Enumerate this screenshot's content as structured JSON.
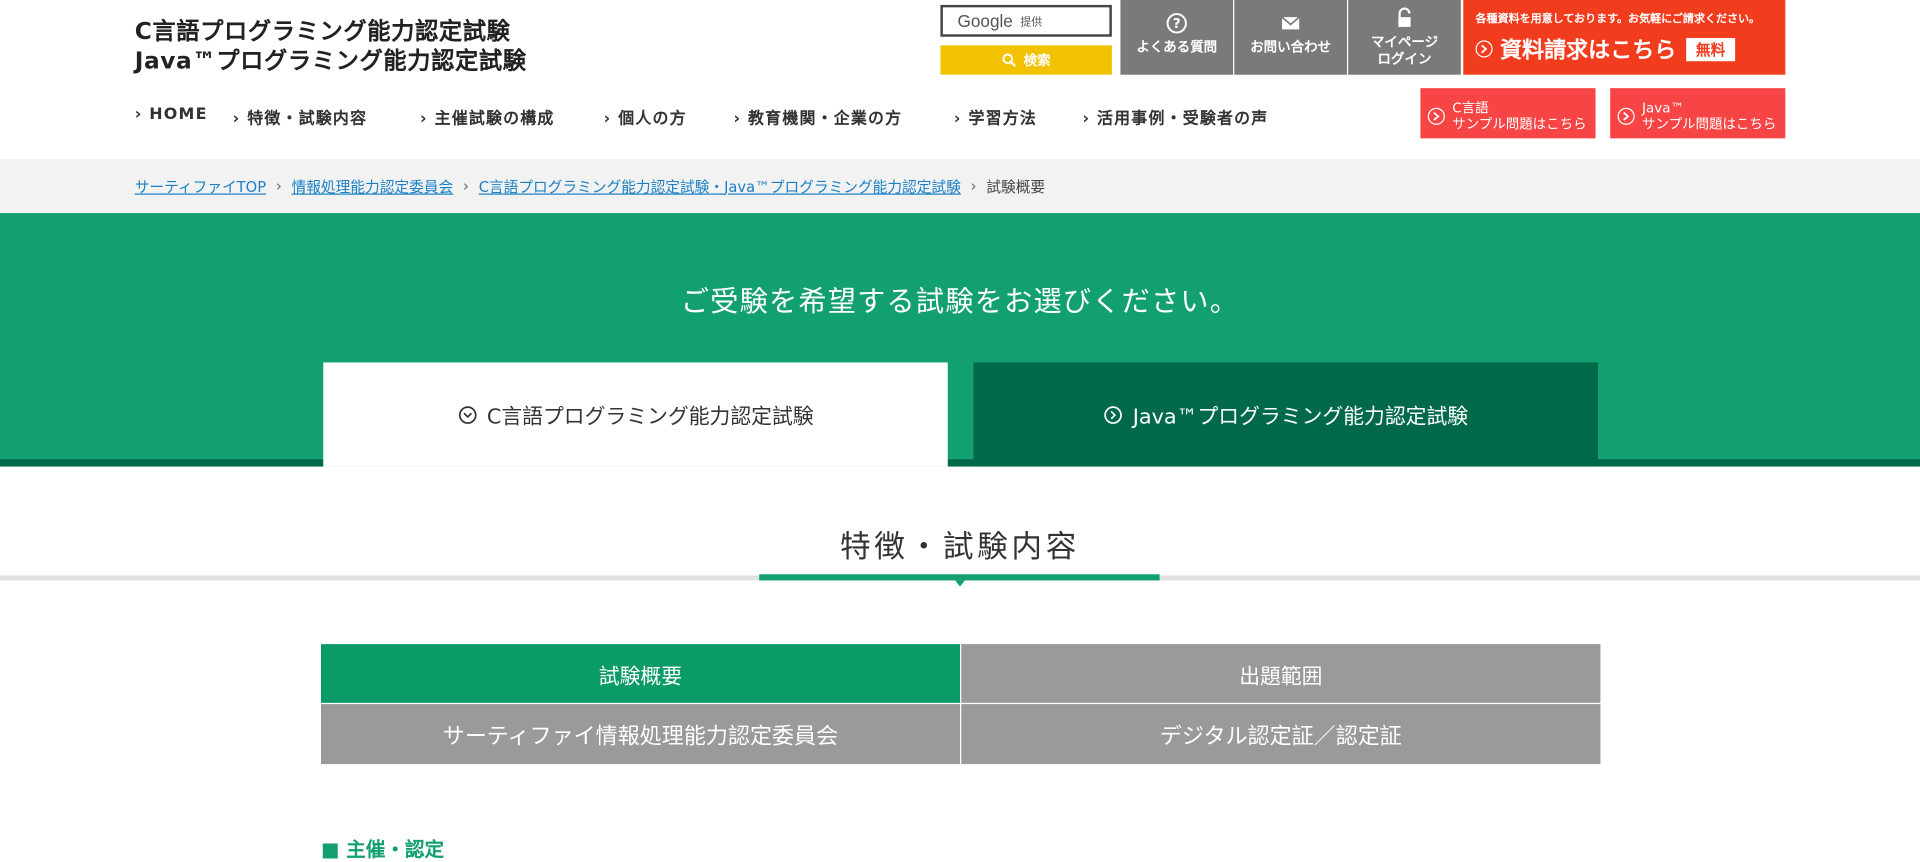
{
  "site": {
    "title_line1": "C言語プログラミング能力認定試験",
    "title_line2": "Java™プログラミング能力認定試験"
  },
  "search": {
    "brand": "Google",
    "provided": "提供",
    "button_label": "検索"
  },
  "utility": [
    {
      "label1": "よくある質問",
      "label2": ""
    },
    {
      "label1": "お問い合わせ",
      "label2": ""
    },
    {
      "label1": "マイページ",
      "label2": "ログイン"
    }
  ],
  "request": {
    "small_text": "各種資料を用意しております。お気軽にご請求ください。",
    "big_text": "資料請求はこちら",
    "free_badge": "無料"
  },
  "nav": [
    "HOME",
    "特徴・試験内容",
    "主催試験の構成",
    "個人の方",
    "教育機関・企業の方",
    "学習方法",
    "活用事例・受験者の声"
  ],
  "samples": [
    {
      "line1": "C言語",
      "line2": "サンプル問題はこちら"
    },
    {
      "line1": "Java™",
      "line2": "サンプル問題はこちら"
    }
  ],
  "breadcrumb": {
    "items": [
      "サーティファイTOP",
      "情報処理能力認定委員会",
      "C言語プログラミング能力認定試験・Java™プログラミング能力認定試験"
    ],
    "current": "試験概要"
  },
  "hero": {
    "title": "ご受験を希望する試験をお選びください。",
    "tab_c": "C言語プログラミング能力認定試験",
    "tab_java": "Java™プログラミング能力認定試験"
  },
  "section": {
    "title": "特徴・試験内容"
  },
  "menu": [
    {
      "label": "試験概要",
      "active": true
    },
    {
      "label": "出題範囲",
      "active": false
    },
    {
      "label": "サーティファイ情報処理能力認定委員会",
      "active": false
    },
    {
      "label": "デジタル認定証／認定証",
      "active": false
    }
  ],
  "sub_heading": "■ 主催・認定",
  "colors": {
    "green": "#13a070",
    "dark_green": "#00694a",
    "active_cell": "#0a9b66",
    "inactive_cell": "#9a9a9a",
    "request_red": "#f23c1e",
    "sample_red": "#f74444",
    "search_yellow": "#f2c100",
    "util_gray": "#7a7a7a"
  },
  "icons": {
    "faq": "question-circle-icon",
    "contact": "envelope-icon",
    "mypage": "padlock-icon",
    "search": "magnifier-icon",
    "arrow": "chevron-right-circle-icon",
    "tab_down": "chevron-down-circle-icon"
  }
}
